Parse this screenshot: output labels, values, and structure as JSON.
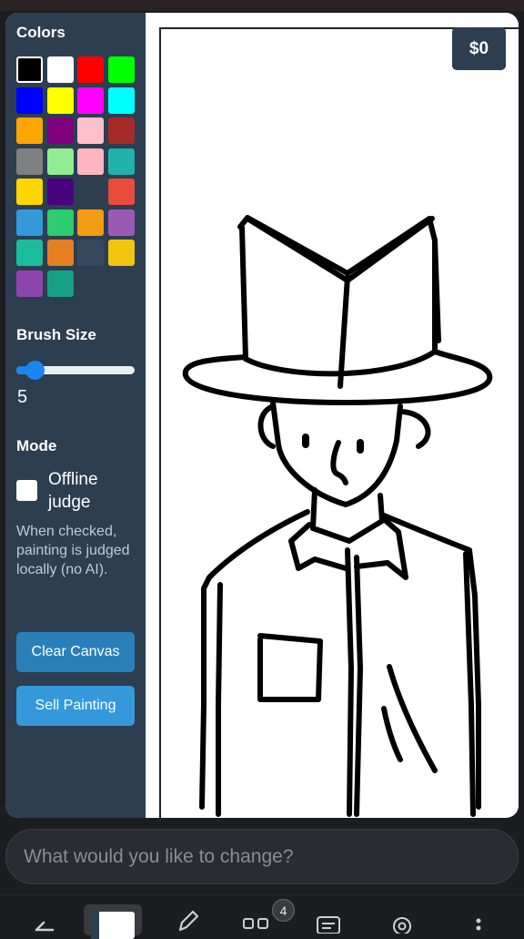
{
  "sidebar": {
    "colors_title": "Colors",
    "palette": [
      "#000000",
      "#ffffff",
      "#ff0000",
      "#00ff00",
      "#0000ff",
      "#ffff00",
      "#ff00ff",
      "#00ffff",
      "#ffa500",
      "#800080",
      "#ffc0cb",
      "#a52a2a",
      "#808080",
      "#90ee90",
      "#ffb6c1",
      "#20b2aa",
      "#ffd700",
      "#4b0082",
      "#2c3e50",
      "#e74c3c",
      "#3498db",
      "#2ecc71",
      "#f39c12",
      "#9b59b6",
      "#1abc9c",
      "#e67e22",
      "#34495e",
      "#f1c40f",
      "#8e44ad",
      "#16a085"
    ],
    "selected_color": "#000000",
    "brush_title": "Brush Size",
    "brush_size": "5",
    "brush_fraction": 0.15,
    "mode_title": "Mode",
    "offline_label": "Offline judge",
    "offline_checked": false,
    "hint": "When checked, painting is judged locally (no AI).",
    "clear_label": "Clear Canvas",
    "sell_label": "Sell Painting"
  },
  "canvas": {
    "money": "$0"
  },
  "prompt": {
    "placeholder": "What would you like to change?"
  },
  "bottom_nav": {
    "tab_count": "4",
    "icons": [
      "back-icon",
      "tab-thumbnail",
      "pencil-icon",
      "tabs-icon",
      "chat-icon",
      "settings-icon",
      "more-icon"
    ]
  }
}
